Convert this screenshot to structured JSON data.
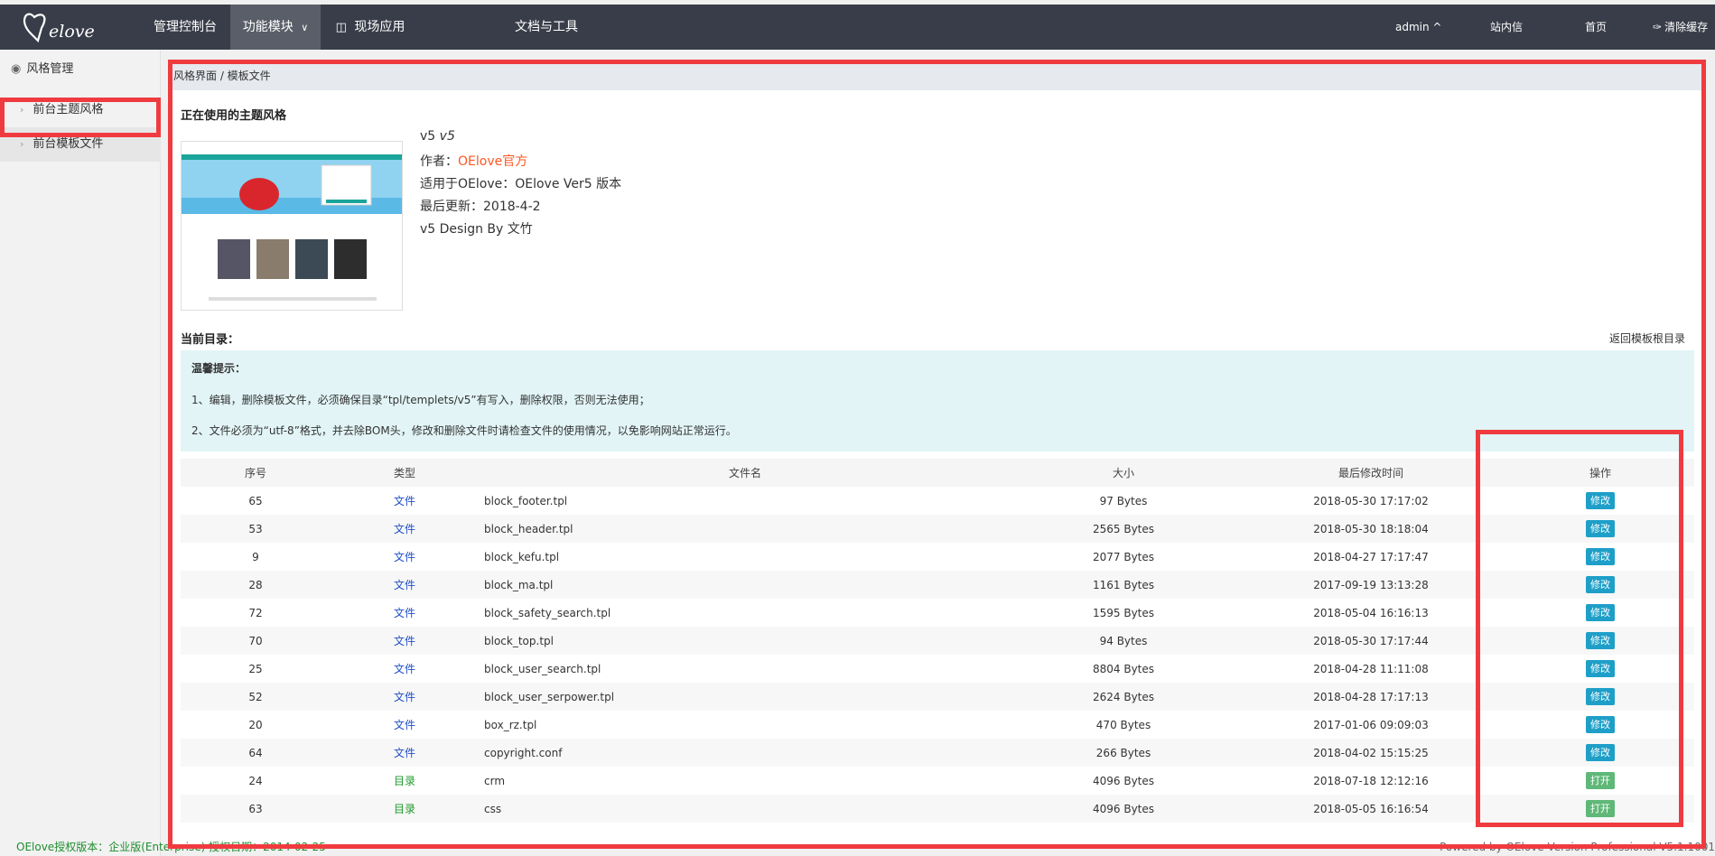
{
  "logo": {
    "text": "Oelove"
  },
  "nav": {
    "items": [
      {
        "label": "管理控制台"
      },
      {
        "label": "功能模块"
      },
      {
        "label": "现场应用"
      },
      {
        "label": "文档与工具"
      }
    ],
    "right": {
      "user": "admin ^",
      "messages": "站内信",
      "home": "首页",
      "clear_cache": "清除缓存"
    }
  },
  "sidebar": {
    "header": "风格管理",
    "items": [
      {
        "label": "前台主题风格"
      },
      {
        "label": "前台模板文件"
      }
    ]
  },
  "breadcrumb": "风格界面 / 模板文件",
  "theme": {
    "section_title": "正在使用的主题风格",
    "name": "v5",
    "name_italic": "v5",
    "author_label": "作者：",
    "author": "OElove官方",
    "compat": "适用于OElove：OElove Ver5 版本",
    "updated": "最后更新：2018-4-2",
    "design": "v5 Design By 文竹"
  },
  "directory": {
    "title": "当前目录：",
    "back_link": "返回模板根目录"
  },
  "tips": {
    "title": "温馨提示：",
    "line1": "1、编辑，删除模板文件，必须确保目录“tpl/templets/v5”有写入，删除权限，否则无法使用；",
    "line2": "2、文件必须为“utf-8”格式，并去除BOM头，修改和删除文件时请检查文件的使用情况，以免影响网站正常运行。"
  },
  "table": {
    "headers": [
      "序号",
      "类型",
      "文件名",
      "大小",
      "最后修改时间",
      "操作"
    ],
    "rows": [
      {
        "id": "65",
        "type": "文件",
        "name": "block_footer.tpl",
        "size": "97 Bytes",
        "mtime": "2018-05-30 17:17:02",
        "action": "修改"
      },
      {
        "id": "53",
        "type": "文件",
        "name": "block_header.tpl",
        "size": "2565 Bytes",
        "mtime": "2018-05-30 18:18:04",
        "action": "修改"
      },
      {
        "id": "9",
        "type": "文件",
        "name": "block_kefu.tpl",
        "size": "2077 Bytes",
        "mtime": "2018-04-27 17:17:47",
        "action": "修改"
      },
      {
        "id": "28",
        "type": "文件",
        "name": "block_ma.tpl",
        "size": "1161 Bytes",
        "mtime": "2017-09-19 13:13:28",
        "action": "修改"
      },
      {
        "id": "72",
        "type": "文件",
        "name": "block_safety_search.tpl",
        "size": "1595 Bytes",
        "mtime": "2018-05-04 16:16:13",
        "action": "修改"
      },
      {
        "id": "70",
        "type": "文件",
        "name": "block_top.tpl",
        "size": "94 Bytes",
        "mtime": "2018-05-30 17:17:44",
        "action": "修改"
      },
      {
        "id": "25",
        "type": "文件",
        "name": "block_user_search.tpl",
        "size": "8804 Bytes",
        "mtime": "2018-04-28 11:11:08",
        "action": "修改"
      },
      {
        "id": "52",
        "type": "文件",
        "name": "block_user_serpower.tpl",
        "size": "2624 Bytes",
        "mtime": "2018-04-28 17:17:13",
        "action": "修改"
      },
      {
        "id": "20",
        "type": "文件",
        "name": "box_rz.tpl",
        "size": "470 Bytes",
        "mtime": "2017-01-06 09:09:03",
        "action": "修改"
      },
      {
        "id": "64",
        "type": "文件",
        "name": "copyright.conf",
        "size": "266 Bytes",
        "mtime": "2018-04-02 15:15:25",
        "action": "修改"
      },
      {
        "id": "24",
        "type": "目录",
        "name": "crm",
        "size": "4096 Bytes",
        "mtime": "2018-07-18 12:12:16",
        "action": "打开"
      },
      {
        "id": "63",
        "type": "目录",
        "name": "css",
        "size": "4096 Bytes",
        "mtime": "2018-05-05 16:16:54",
        "action": "打开"
      }
    ]
  },
  "footer": {
    "license": "OElove授权版本：企业版(Enterprise) 授权日期：2014-02-25",
    "powered": "Powered by OElove Version Professional V5.1.1001"
  },
  "colors": {
    "topbar": "#393d49",
    "highlight": "#ef3b3f",
    "author": "#ff5722",
    "edit_button": "#1e9fc8",
    "open_button": "#5fb878"
  }
}
